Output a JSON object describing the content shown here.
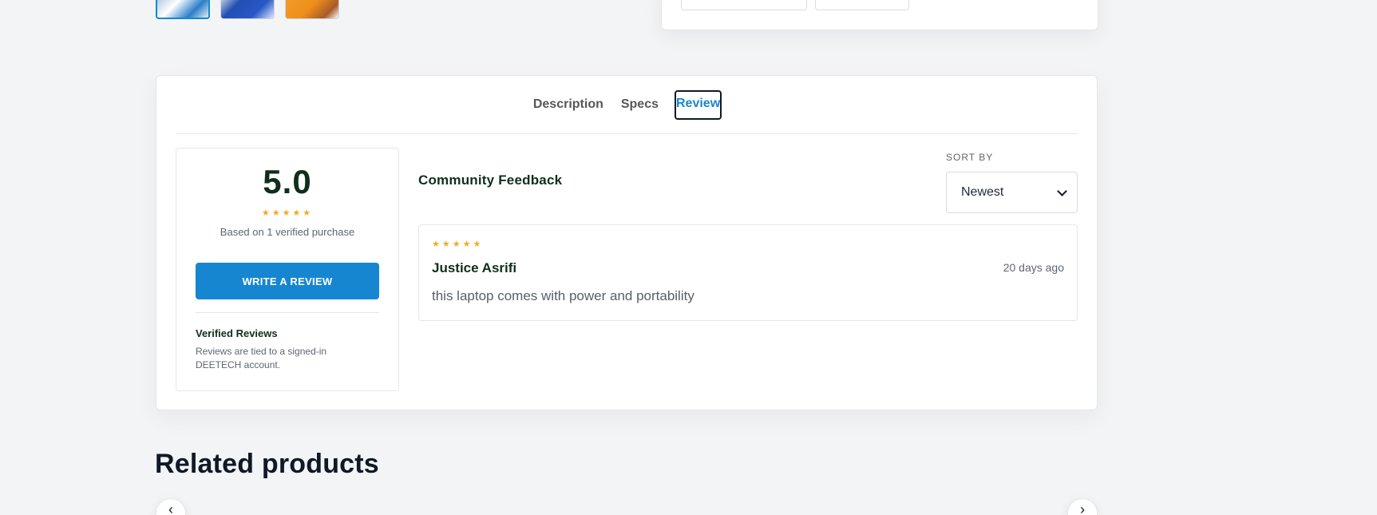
{
  "gallery": {
    "thumbnails": [
      {
        "label": "Product image 1",
        "active": true
      },
      {
        "label": "Product image 2",
        "active": false
      },
      {
        "label": "Product image 3",
        "active": false
      }
    ]
  },
  "tabs": [
    {
      "label": "Description",
      "active": false
    },
    {
      "label": "Specs",
      "active": false
    },
    {
      "label": "Review",
      "active": true
    }
  ],
  "summary": {
    "rating": "5.0",
    "stars": "★★★★★",
    "based_on": "Based on 1 verified purchase",
    "button_label": "WRITE A REVIEW",
    "verified_title": "Verified Reviews",
    "verified_text": "Reviews are tied to a signed-in DEETECH account."
  },
  "feedback": {
    "title": "Community Feedback",
    "sort_label": "SORT BY",
    "sort_value": "Newest"
  },
  "reviews": [
    {
      "stars": "★★★★★",
      "author": "Justice Asrifi",
      "date": "20 days ago",
      "text": "this laptop comes with power and portability"
    }
  ],
  "related": {
    "title": "Related products",
    "prev_icon": "‹",
    "next_icon": "›"
  },
  "colors": {
    "accent": "#1686d0",
    "star": "#f2aa1f",
    "dark_green": "#0f2f1a",
    "background": "#f3f4f6"
  }
}
